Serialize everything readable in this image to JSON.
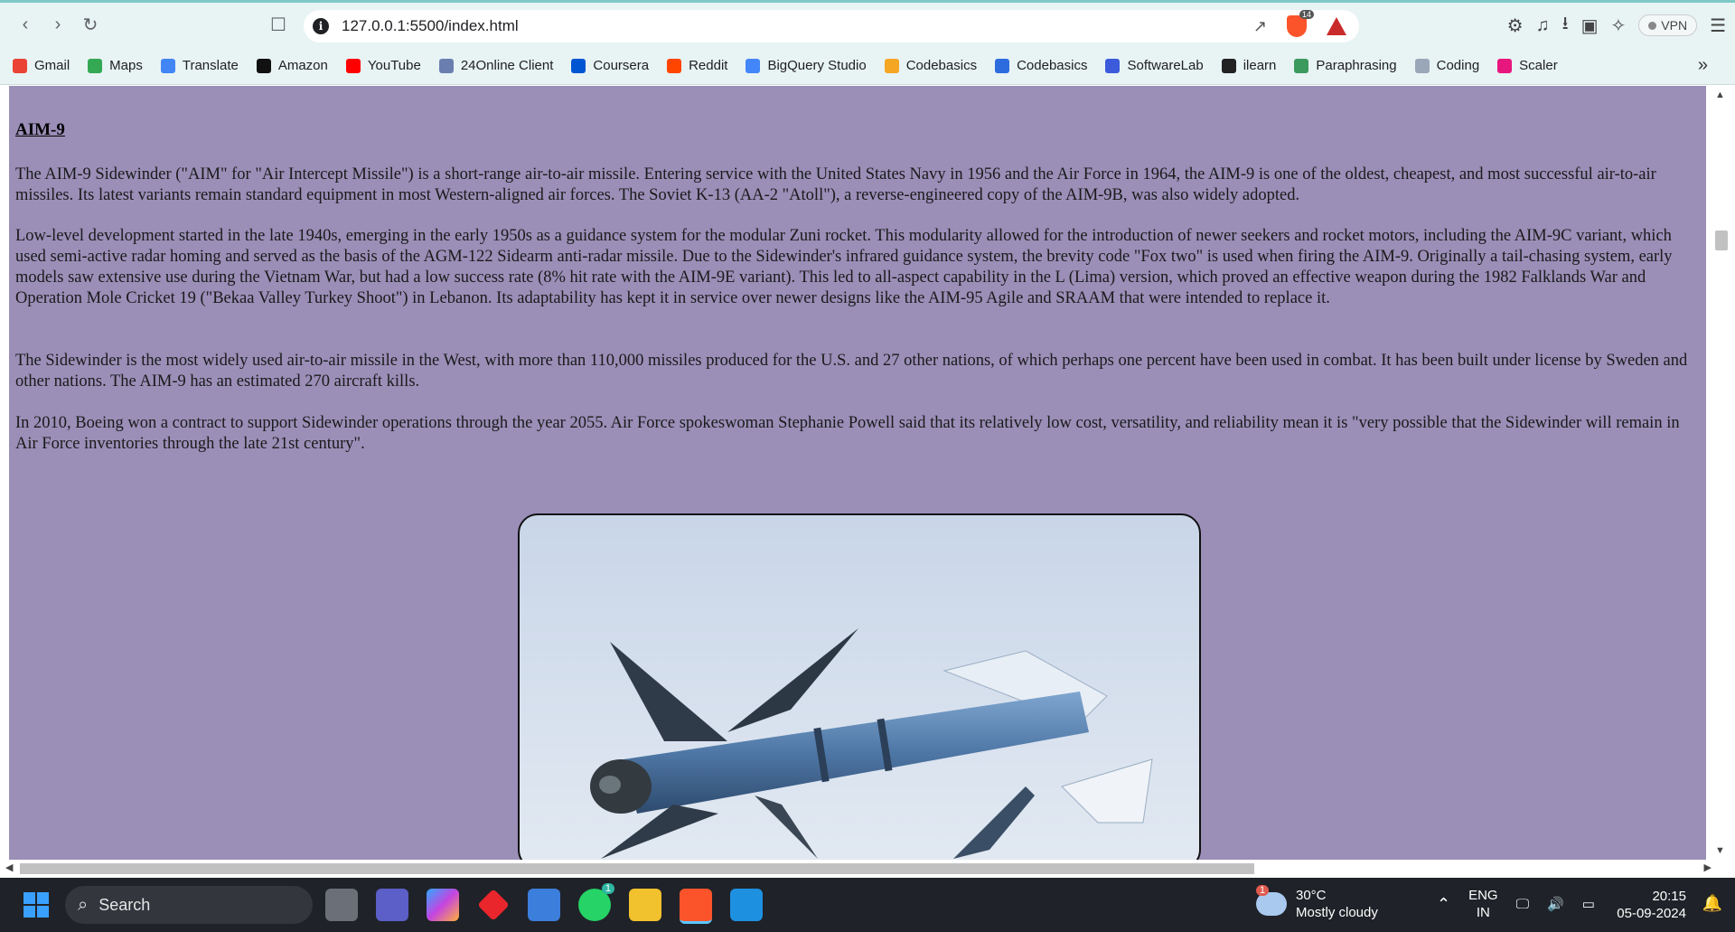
{
  "browser": {
    "url": "127.0.0.1:5500/index.html",
    "shields_count": "14",
    "vpn_label": "VPN",
    "bookmarks": [
      {
        "label": "Gmail",
        "icon": "gmail-icon",
        "color": "#ea4335"
      },
      {
        "label": "Maps",
        "icon": "maps-icon",
        "color": "#34a853"
      },
      {
        "label": "Translate",
        "icon": "translate-icon",
        "color": "#4285f4"
      },
      {
        "label": "Amazon",
        "icon": "amazon-icon",
        "color": "#111111"
      },
      {
        "label": "YouTube",
        "icon": "youtube-icon",
        "color": "#ff0000"
      },
      {
        "label": "24Online Client",
        "icon": "24online-icon",
        "color": "#6a7fb0"
      },
      {
        "label": "Coursera",
        "icon": "coursera-icon",
        "color": "#0056d2"
      },
      {
        "label": "Reddit",
        "icon": "reddit-icon",
        "color": "#ff4500"
      },
      {
        "label": "BigQuery Studio",
        "icon": "bigquery-icon",
        "color": "#4386fa"
      },
      {
        "label": "Codebasics",
        "icon": "rocket-icon",
        "color": "#f5a623"
      },
      {
        "label": "Codebasics",
        "icon": "codebasics-icon",
        "color": "#2d6cdf"
      },
      {
        "label": "SoftwareLab",
        "icon": "softwarelab-icon",
        "color": "#3b5bdb"
      },
      {
        "label": "ilearn",
        "icon": "ilearn-icon",
        "color": "#222222"
      },
      {
        "label": "Paraphrasing",
        "icon": "paraphrasing-icon",
        "color": "#3c9a5f"
      },
      {
        "label": "Coding",
        "icon": "coding-icon",
        "color": "#9aa7b8"
      },
      {
        "label": "Scaler",
        "icon": "scaler-icon",
        "color": "#e8177d"
      }
    ],
    "more_label": "»"
  },
  "page": {
    "background": "#9b8fb8",
    "heading": "AIM-9",
    "paragraphs": [
      "The AIM-9 Sidewinder (\"AIM\" for \"Air Intercept Missile\") is a short-range air-to-air missile. Entering service with the United States Navy in 1956 and the Air Force in 1964, the AIM-9 is one of the oldest, cheapest, and most successful air-to-air missiles. Its latest variants remain standard equipment in most Western-aligned air forces. The Soviet K-13 (AA-2 \"Atoll\"), a reverse-engineered copy of the AIM-9B, was also widely adopted.",
      "Low-level development started in the late 1940s, emerging in the early 1950s as a guidance system for the modular Zuni rocket. This modularity allowed for the introduction of newer seekers and rocket motors, including the AIM-9C variant, which used semi-active radar homing and served as the basis of the AGM-122 Sidearm anti-radar missile. Due to the Sidewinder's infrared guidance system, the brevity code \"Fox two\" is used when firing the AIM-9. Originally a tail-chasing system, early models saw extensive use during the Vietnam War, but had a low success rate (8% hit rate with the AIM-9E variant). This led to all-aspect capability in the L (Lima) version, which proved an effective weapon during the 1982 Falklands War and Operation Mole Cricket 19 (\"Bekaa Valley Turkey Shoot\") in Lebanon. Its adaptability has kept it in service over newer designs like the AIM-95 Agile and SRAAM that were intended to replace it.",
      "The Sidewinder is the most widely used air-to-air missile in the West, with more than 110,000 missiles produced for the U.S. and 27 other nations, of which perhaps one percent have been used in combat. It has been built under license by Sweden and other nations. The AIM-9 has an estimated 270 aircraft kills.",
      "In 2010, Boeing won a contract to support Sidewinder operations through the year 2055. Air Force spokeswoman Stephanie Powell said that its relatively low cost, versatility, and reliability mean it is \"very possible that the Sidewinder will remain in Air Force inventories through the late 21st century\"."
    ]
  },
  "taskbar": {
    "search_label": "Search",
    "whatsapp_badge": "1",
    "weather_badge": "1",
    "temperature": "30°C",
    "weather_desc": "Mostly cloudy",
    "lang_1": "ENG",
    "lang_2": "IN",
    "time": "20:15",
    "date": "05-09-2024"
  }
}
